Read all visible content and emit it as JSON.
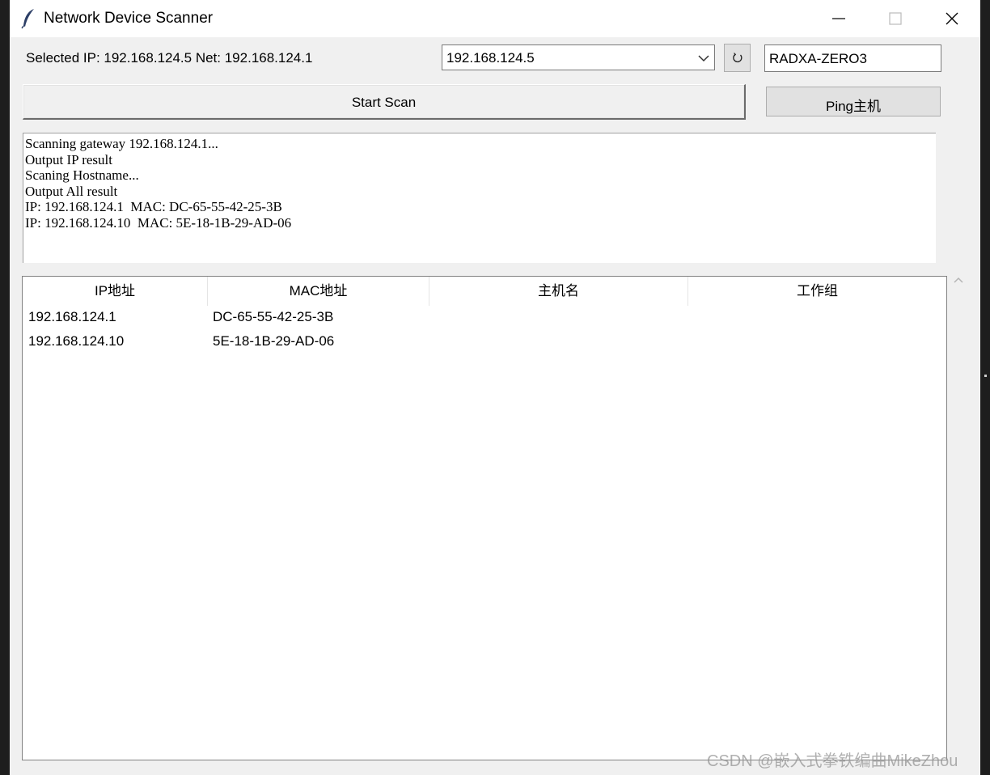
{
  "window": {
    "title": "Network Device Scanner",
    "controls": [
      "minimize",
      "maximize",
      "close"
    ]
  },
  "toolbar": {
    "selected_label": "Selected IP: 192.168.124.5 Net: 192.168.124.1",
    "ip_combo_value": "192.168.124.5",
    "hostname_value": "RADXA-ZERO3",
    "start_scan_label": "Start Scan",
    "ping_label": "Ping主机"
  },
  "log": {
    "lines": [
      "Scanning gateway 192.168.124.1...",
      "Output IP result",
      "Scaning Hostname...",
      "Output All result",
      "IP: 192.168.124.1  MAC: DC-65-55-42-25-3B",
      "IP: 192.168.124.10  MAC: 5E-18-1B-29-AD-06"
    ]
  },
  "table": {
    "columns": [
      "IP地址",
      "MAC地址",
      "主机名",
      "工作组"
    ],
    "rows": [
      {
        "ip": "192.168.124.1",
        "mac": "DC-65-55-42-25-3B",
        "host": "",
        "group": ""
      },
      {
        "ip": "192.168.124.10",
        "mac": "5E-18-1B-29-AD-06",
        "host": "",
        "group": ""
      }
    ]
  },
  "watermark": "CSDN @嵌入式拳铁编曲MikeZhou",
  "icons": {
    "app": "feather-icon",
    "combo": "chevron-down-icon",
    "refresh": "refresh-icon",
    "scroll": "chevron-up-icon"
  }
}
